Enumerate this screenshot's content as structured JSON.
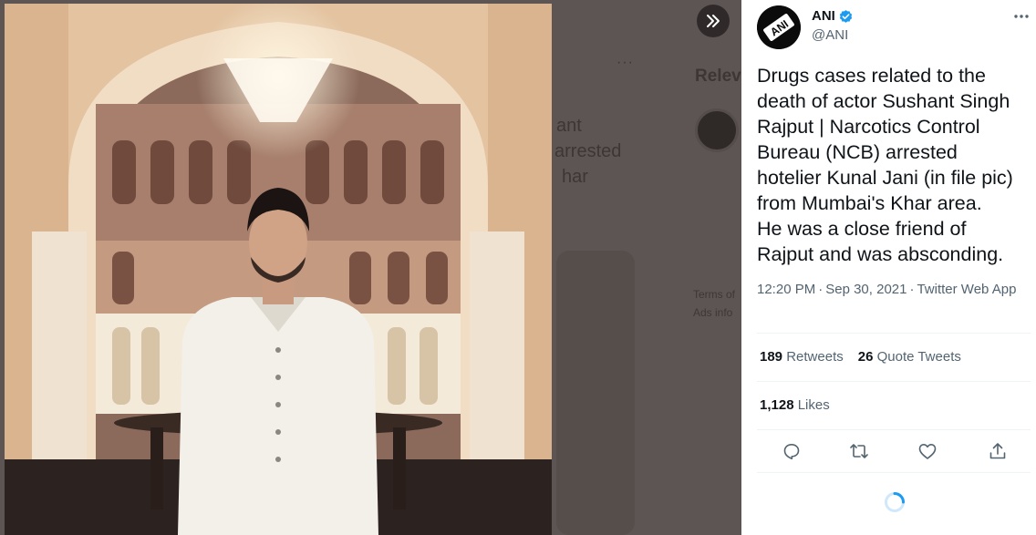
{
  "background": {
    "relevant_heading": "Relev",
    "dots": "···",
    "snippet_lines": [
      "ant",
      "arrested",
      "har"
    ],
    "footer_links": [
      "Terms of",
      "Ads info"
    ]
  },
  "photo": {
    "icon": "tweet-photo"
  },
  "nav": {
    "next_icon": "double-chevron-right-icon"
  },
  "tweet": {
    "author": {
      "name": "ANI",
      "handle": "@ANI",
      "avatar_text": "ANI",
      "verified": true
    },
    "text": "Drugs cases related to the\ndeath of actor Sushant Singh\nRajput | Narcotics Control\nBureau (NCB) arrested\nhotelier Kunal Jani (in file pic)\nfrom Mumbai's Khar area.\nHe was a close friend of\nRajput and was absconding.",
    "time": "12:20 PM",
    "date": "Sep 30, 2021",
    "separator": "·",
    "source": "Twitter Web App",
    "stats": {
      "retweets_count": "189",
      "retweets_label": "Retweets",
      "quote_count": "26",
      "quote_label": "Quote Tweets",
      "likes_count": "1,128",
      "likes_label": "Likes"
    },
    "actions": [
      "reply-icon",
      "retweet-icon",
      "like-icon",
      "share-icon"
    ]
  },
  "colors": {
    "accent": "#1d9bf0",
    "text": "#0f1419",
    "secondary": "#536471",
    "backdrop": "#5d5553"
  }
}
